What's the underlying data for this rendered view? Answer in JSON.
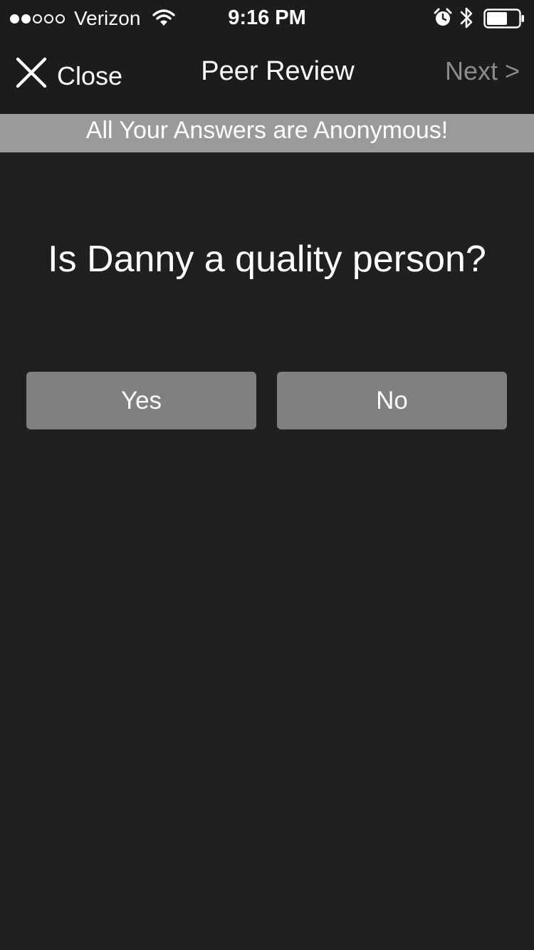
{
  "status_bar": {
    "carrier": "Verizon",
    "time": "9:16 PM",
    "signal_bars_filled": 2,
    "signal_bars_total": 5,
    "battery_level": 0.65,
    "icons": [
      "signal-icon",
      "wifi-icon",
      "alarm-icon",
      "bluetooth-icon",
      "battery-icon"
    ]
  },
  "nav": {
    "close_label": "Close",
    "title": "Peer Review",
    "next_label": "Next >"
  },
  "banner": {
    "text": "All Your Answers are Anonymous!"
  },
  "question": {
    "text": "Is Danny a quality person?"
  },
  "answers": {
    "yes_label": "Yes",
    "no_label": "No"
  },
  "colors": {
    "background": "#1f2022",
    "banner": "#9a9a9a",
    "button": "#7f8180",
    "next_disabled": "#8b8c8e"
  }
}
